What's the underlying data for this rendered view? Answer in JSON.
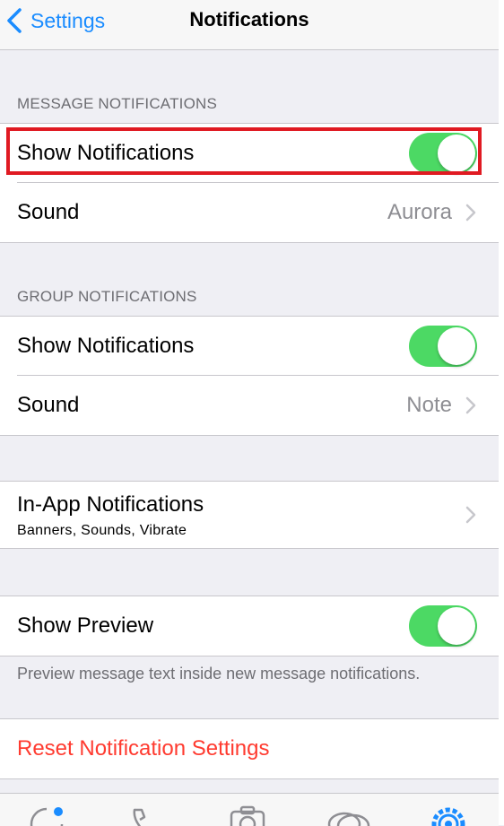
{
  "navbar": {
    "back_label": "Settings",
    "title": "Notifications"
  },
  "message_notifications": {
    "header": "MESSAGE NOTIFICATIONS",
    "show_label": "Show Notifications",
    "show_enabled": true,
    "sound_label": "Sound",
    "sound_value": "Aurora"
  },
  "group_notifications": {
    "header": "GROUP NOTIFICATIONS",
    "show_label": "Show Notifications",
    "show_enabled": true,
    "sound_label": "Sound",
    "sound_value": "Note"
  },
  "in_app": {
    "title": "In-App Notifications",
    "subtitle": "Banners, Sounds, Vibrate"
  },
  "preview": {
    "label": "Show Preview",
    "enabled": true,
    "footer": "Preview message text inside new message notifications."
  },
  "reset": {
    "label": "Reset Notification Settings"
  },
  "colors": {
    "accent": "#1a8cff",
    "toggle_on": "#4cd964",
    "destructive": "#ff3b30",
    "highlight": "#e01a22"
  },
  "tabbar": {
    "icons": [
      "status-icon",
      "calls-icon",
      "camera-icon",
      "chats-icon",
      "settings-icon"
    ],
    "active": "settings-icon"
  }
}
